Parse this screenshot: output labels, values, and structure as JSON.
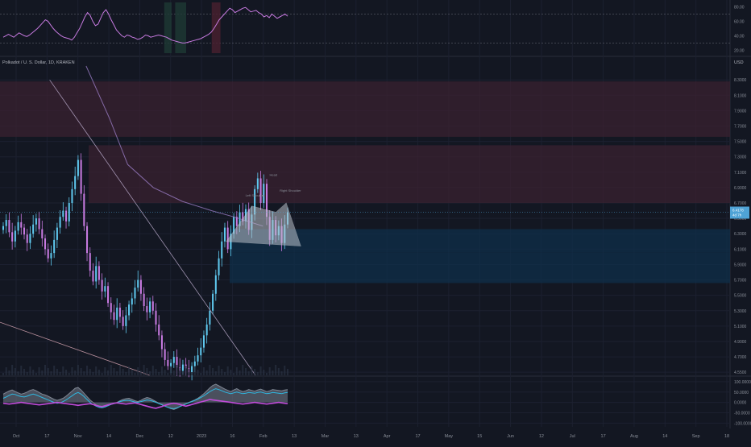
{
  "legend": {
    "symbol_line": "Polkadot / U. S. Dollar, 1D, KRAKEN"
  },
  "currency_label": "USD",
  "pattern_labels": {
    "left_shoulder": "Left Shoulder",
    "head": "Head",
    "right_shoulder": "Right Shoulder"
  },
  "current_price_badge": [
    "6.4178",
    "4d 7h"
  ],
  "colors": {
    "background": "#131722",
    "up_candle": "#5fc8ee",
    "down_candle": "#c77ae0",
    "rsi_line": "#c77ae0",
    "osc_cyan": "#2fb7e0",
    "osc_magenta": "#c04bd8",
    "zone_red": "#3a2230",
    "zone_blue": "#0f2f4a",
    "pattern_fill": "#b9bfc9"
  },
  "chart_data": [
    {
      "type": "line",
      "panel": "rsi",
      "ylim": [
        16,
        86
      ],
      "ticks": [
        20,
        40,
        60,
        80
      ],
      "tick_labels": [
        "20.00",
        "40.00",
        "60.00",
        "80.00"
      ],
      "bands": [
        30,
        70
      ],
      "series": [
        {
          "values": [
            38,
            40,
            42,
            40,
            38,
            41,
            44,
            42,
            40,
            39,
            41,
            44,
            47,
            50,
            54,
            58,
            62,
            60,
            55,
            50,
            46,
            43,
            40,
            38,
            37,
            36,
            34,
            38,
            44,
            50,
            58,
            66,
            72,
            68,
            60,
            54,
            56,
            64,
            72,
            76,
            70,
            62,
            55,
            48,
            44,
            40,
            38,
            41,
            40,
            38,
            37,
            35,
            36,
            38,
            41,
            40,
            38,
            39,
            40,
            41,
            40,
            39,
            38,
            36,
            34,
            33,
            32,
            31,
            30,
            30,
            31,
            32,
            33,
            34,
            35,
            36,
            38,
            40,
            42,
            45,
            50,
            56,
            62,
            66,
            70,
            74,
            78,
            76,
            72,
            74,
            76,
            78,
            79,
            76,
            73,
            74,
            75,
            72,
            70,
            66,
            68,
            65,
            70,
            67,
            64,
            66,
            68,
            70,
            67
          ]
        }
      ]
    },
    {
      "type": "candlestick",
      "panel": "main",
      "ylim": [
        4.46,
        8.48
      ],
      "ticks": [
        4.5,
        4.7,
        4.9,
        5.1,
        5.3,
        5.5,
        5.7,
        5.9,
        6.1,
        6.3,
        6.5,
        6.7,
        6.9,
        7.1,
        7.3,
        7.5,
        7.7,
        7.9,
        8.1,
        8.3
      ],
      "tick_labels": [
        "4.5500",
        "4.7000",
        "4.9000",
        "5.1000",
        "5.3000",
        "5.5000",
        "5.7000",
        "5.9000",
        "6.1000",
        "6.3000",
        "6.5000",
        "6.7000",
        "6.9000",
        "7.1000",
        "7.3000",
        "7.5000",
        "7.7000",
        "7.9000",
        "8.1000",
        "8.3000"
      ],
      "x_labels": [
        "Oct",
        "17",
        "Nov",
        "14",
        "Dec",
        "12",
        "2023",
        "16",
        "Feb",
        "13",
        "Mar",
        "13",
        "Apr",
        "17",
        "May",
        "15",
        "Jun",
        "12",
        "Jul",
        "17",
        "Aug",
        "14",
        "Sep",
        "18"
      ],
      "closes": [
        6.4,
        6.48,
        6.32,
        6.2,
        6.34,
        6.45,
        6.38,
        6.29,
        6.18,
        6.3,
        6.42,
        6.5,
        6.36,
        6.24,
        6.1,
        5.98,
        6.05,
        6.22,
        6.38,
        6.52,
        6.6,
        6.46,
        6.7,
        6.88,
        7.05,
        7.26,
        6.82,
        6.4,
        6.05,
        5.82,
        5.68,
        5.88,
        5.7,
        5.55,
        5.62,
        5.4,
        5.28,
        5.18,
        5.34,
        5.22,
        5.1,
        5.24,
        5.38,
        5.46,
        5.6,
        5.7,
        5.52,
        5.36,
        5.28,
        5.42,
        5.3,
        5.12,
        4.98,
        4.8,
        4.66,
        4.58,
        4.62,
        4.7,
        4.56,
        4.52,
        4.6,
        4.55,
        4.5,
        4.58,
        4.64,
        4.72,
        4.82,
        4.98,
        5.12,
        5.3,
        5.52,
        5.76,
        5.98,
        6.2,
        6.38,
        6.1,
        6.3,
        6.52,
        6.4,
        6.58,
        6.46,
        6.62,
        6.35,
        6.55,
        6.88,
        7.02,
        6.7,
        6.95,
        6.52,
        6.22,
        6.48,
        6.28,
        6.4,
        6.18,
        6.42,
        6.58
      ],
      "zones": [
        {
          "kind": "red",
          "from": 7.56,
          "to": 8.28
        },
        {
          "kind": "red",
          "from": 6.7,
          "to": 7.45
        },
        {
          "kind": "blue",
          "from": 6.06,
          "to": 6.36
        },
        {
          "kind": "blue",
          "from": 5.66,
          "to": 6.06
        }
      ],
      "moving_average": [
        [
          8.48,
          0.118
        ],
        [
          7.8,
          0.15
        ],
        [
          7.2,
          0.175
        ],
        [
          6.9,
          0.21
        ],
        [
          6.72,
          0.25
        ],
        [
          6.6,
          0.29
        ],
        [
          6.52,
          0.32
        ],
        [
          6.4,
          0.36
        ]
      ],
      "trendline_1": [
        [
          8.3,
          0.068
        ],
        [
          4.46,
          0.35
        ]
      ],
      "trendline_2": [
        [
          5.15,
          0.0
        ],
        [
          4.46,
          0.205
        ]
      ],
      "head_and_shoulders": [
        [
          6.2,
          0.31
        ],
        [
          6.66,
          0.345
        ],
        [
          6.58,
          0.378
        ],
        [
          6.7,
          0.392
        ],
        [
          6.14,
          0.412
        ]
      ]
    },
    {
      "type": "area",
      "panel": "oscillator",
      "ylim": [
        -110,
        115
      ],
      "ticks": [
        100,
        50,
        0,
        -50,
        -100
      ],
      "tick_labels": [
        "100.0000",
        "50.0000",
        "0.0000",
        "-50.0000",
        "-100.0000"
      ],
      "series": [
        {
          "values": [
            40,
            48,
            55,
            60,
            52,
            46,
            40,
            44,
            50,
            58,
            62,
            56,
            48,
            40,
            36,
            30,
            22,
            15,
            10,
            14,
            20,
            30,
            42,
            55,
            68,
            72,
            60,
            44,
            28,
            12,
            0,
            -12,
            -20,
            -25,
            -22,
            -15,
            -10,
            -5,
            0,
            8,
            14,
            18,
            20,
            14,
            8,
            4,
            10,
            18,
            24,
            20,
            12,
            4,
            -4,
            -10,
            -18,
            -24,
            -30,
            -34,
            -28,
            -20,
            -12,
            -6,
            0,
            6,
            12,
            20,
            30,
            42,
            56,
            70,
            82,
            88,
            80,
            72,
            64,
            58,
            52,
            60,
            66,
            58,
            52,
            56,
            62,
            58,
            54,
            60,
            64,
            58,
            52,
            56,
            62,
            60,
            58,
            56,
            60,
            62
          ]
        },
        {
          "values": [
            20,
            26,
            34,
            40,
            38,
            32,
            28,
            26,
            30,
            36,
            40,
            36,
            30,
            24,
            18,
            12,
            6,
            0,
            -4,
            -2,
            4,
            12,
            22,
            32,
            42,
            48,
            40,
            28,
            14,
            0,
            -10,
            -18,
            -24,
            -26,
            -22,
            -16,
            -10,
            -6,
            -2,
            4,
            8,
            10,
            10,
            6,
            2,
            0,
            4,
            8,
            12,
            10,
            6,
            0,
            -6,
            -12,
            -18,
            -24,
            -28,
            -30,
            -26,
            -20,
            -14,
            -8,
            -2,
            4,
            10,
            16,
            24,
            32,
            42,
            52,
            60,
            66,
            62,
            56,
            50,
            46,
            42,
            46,
            50,
            46,
            42,
            44,
            48,
            46,
            44,
            48,
            50,
            46,
            42,
            44,
            48,
            46,
            44,
            42,
            46,
            48
          ]
        },
        {
          "values": [
            -4,
            -6,
            -8,
            -6,
            -4,
            -2,
            0,
            -2,
            -4,
            -6,
            -8,
            -10,
            -12,
            -10,
            -8,
            -6,
            -4,
            -2,
            0,
            -2,
            -4,
            -6,
            -8,
            -10,
            -12,
            -14,
            -12,
            -10,
            -8,
            -6,
            -10,
            -14,
            -18,
            -20,
            -16,
            -12,
            -8,
            -4,
            -2,
            -4,
            -6,
            -8,
            -6,
            -4,
            -2,
            -6,
            -10,
            -14,
            -18,
            -22,
            -26,
            -28,
            -24,
            -20,
            -14,
            -10,
            -6,
            -4,
            -6,
            -10,
            -14,
            -18,
            -14,
            -10,
            -6,
            -2,
            2,
            6,
            10,
            14,
            12,
            10,
            8,
            6,
            4,
            2,
            0,
            -2,
            -4,
            -6,
            -8,
            -6,
            -4,
            -2,
            0,
            -2,
            -4,
            -6,
            -8,
            -6,
            -4,
            -2,
            0,
            -2,
            -4,
            -6
          ]
        }
      ]
    }
  ]
}
